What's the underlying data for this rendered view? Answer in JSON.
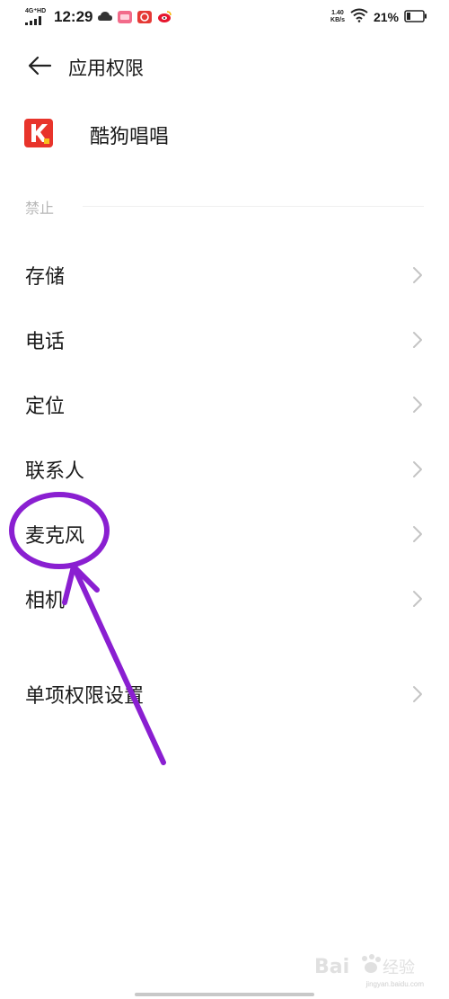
{
  "status_bar": {
    "network_label": "4G⁺HD",
    "time": "12:29",
    "speed_value": "1.40",
    "speed_unit": "KB/s",
    "battery": "21%"
  },
  "header": {
    "title": "应用权限"
  },
  "app": {
    "name": "酷狗唱唱",
    "icon_letter": "K"
  },
  "section": {
    "label": "禁止"
  },
  "permissions": [
    {
      "label": "存储"
    },
    {
      "label": "电话"
    },
    {
      "label": "定位"
    },
    {
      "label": "联系人"
    },
    {
      "label": "麦克风"
    },
    {
      "label": "相机"
    }
  ],
  "single_setting": {
    "label": "单项权限设置"
  },
  "watermark": {
    "brand": "Bai",
    "brand_suffix": "经验",
    "url": "jingyan.baidu.com"
  },
  "colors": {
    "annotation": "#8a1fd1",
    "app_icon_bg": "#e8342b",
    "chevron": "#c4c4c4"
  }
}
